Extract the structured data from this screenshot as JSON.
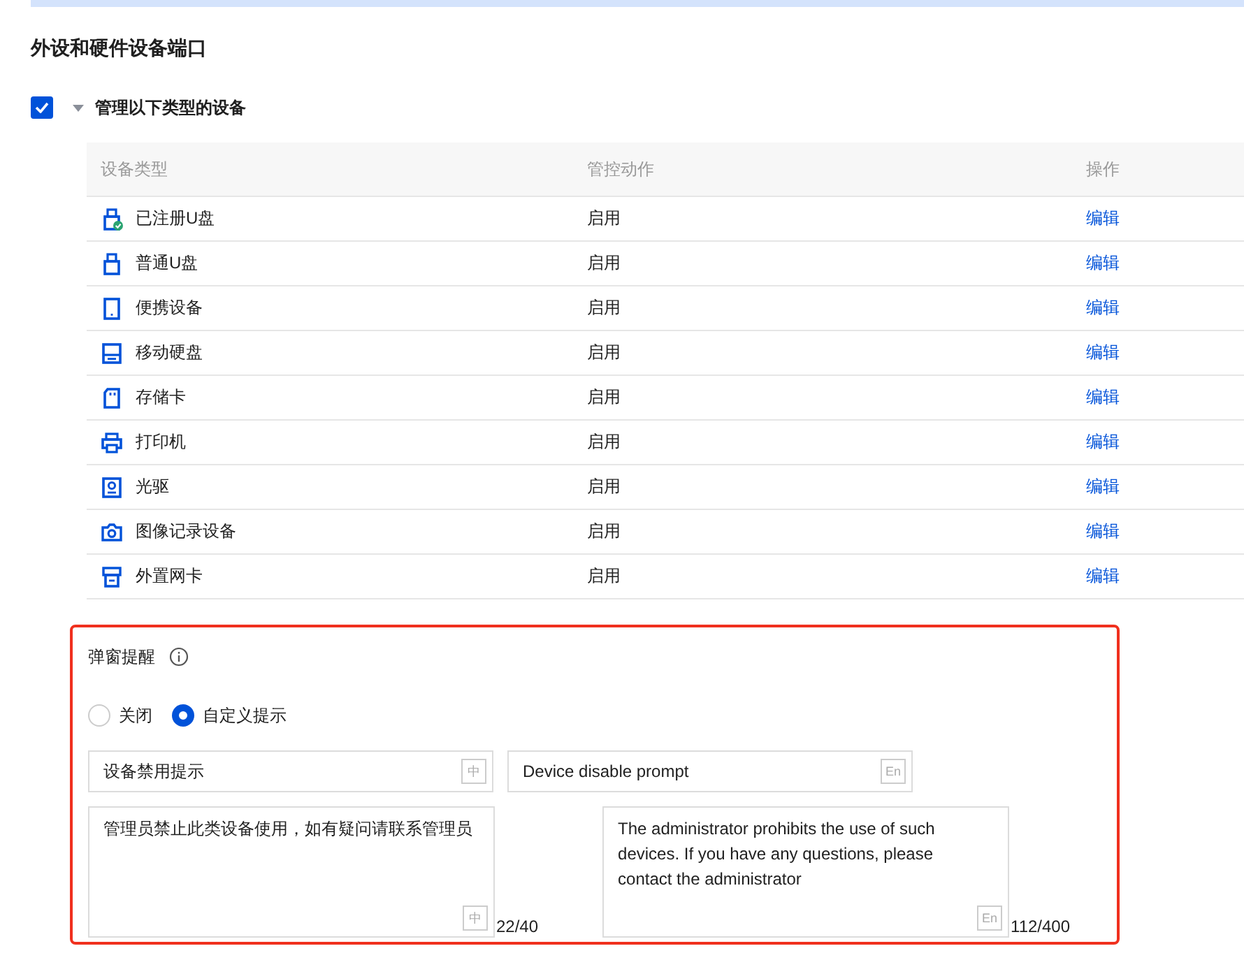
{
  "section_title": "外设和硬件设备端口",
  "manage": {
    "checked": true,
    "expanded": true,
    "label": "管理以下类型的设备"
  },
  "table": {
    "columns": [
      "设备类型",
      "管控动作",
      "操作"
    ],
    "rows": [
      {
        "kind": "usb-registered",
        "name": "已注册U盘",
        "action": "启用",
        "link": "编辑"
      },
      {
        "kind": "usb",
        "name": "普通U盘",
        "action": "启用",
        "link": "编辑"
      },
      {
        "kind": "portable",
        "name": "便携设备",
        "action": "启用",
        "link": "编辑"
      },
      {
        "kind": "disk",
        "name": "移动硬盘",
        "action": "启用",
        "link": "编辑"
      },
      {
        "kind": "card",
        "name": "存储卡",
        "action": "启用",
        "link": "编辑"
      },
      {
        "kind": "printer",
        "name": "打印机",
        "action": "启用",
        "link": "编辑"
      },
      {
        "kind": "optical",
        "name": "光驱",
        "action": "启用",
        "link": "编辑"
      },
      {
        "kind": "camera",
        "name": "图像记录设备",
        "action": "启用",
        "link": "编辑"
      },
      {
        "kind": "nic",
        "name": "外置网卡",
        "action": "启用",
        "link": "编辑"
      }
    ]
  },
  "popup": {
    "title": "弹窗提醒",
    "options": [
      {
        "label": "关闭",
        "selected": false
      },
      {
        "label": "自定义提示",
        "selected": true
      }
    ],
    "title_zh": {
      "value": "设备禁用提示",
      "lang": "中"
    },
    "title_en": {
      "value": "Device disable prompt",
      "lang": "En"
    },
    "body_zh": {
      "value": "管理员禁止此类设备使用，如有疑问请联系管理员",
      "lang": "中",
      "count": "22/40"
    },
    "body_en": {
      "value": "The administrator prohibits the use of such devices. If you have any questions, please contact the administrator",
      "lang": "En",
      "count": "112/400"
    }
  }
}
